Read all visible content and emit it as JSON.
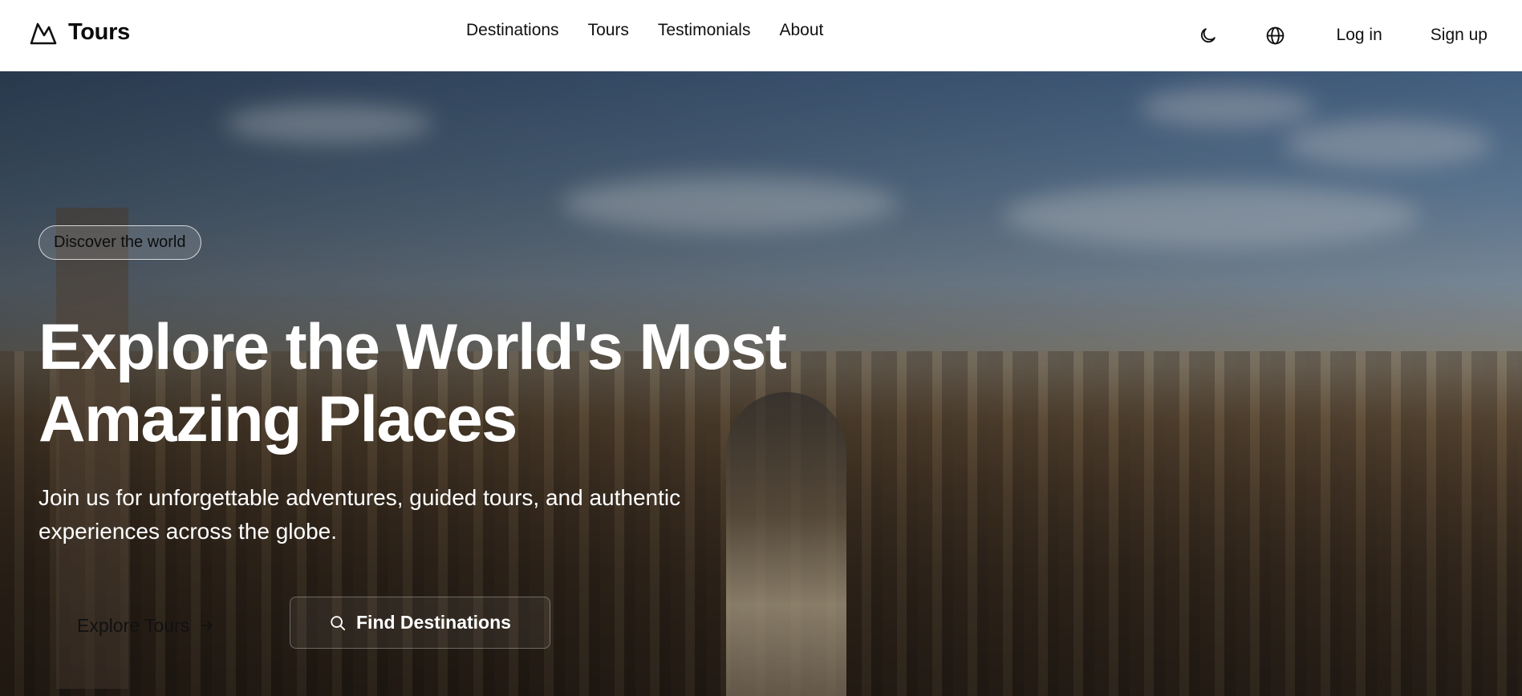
{
  "brand": {
    "name": "Tours",
    "icon": "mountain-icon"
  },
  "nav": {
    "items": [
      {
        "label": "Destinations"
      },
      {
        "label": "Tours"
      },
      {
        "label": "Testimonials"
      },
      {
        "label": "About"
      }
    ]
  },
  "actions": {
    "theme_icon": "moon-icon",
    "language_icon": "globe-icon",
    "login_label": "Log in",
    "signup_label": "Sign up"
  },
  "hero": {
    "badge": "Discover the world",
    "headline_line1": "Explore the World's Most",
    "headline_line2": "Amazing Places",
    "subtext_line1": "Join us for unforgettable adventures, guided tours, and authentic",
    "subtext_line2": "experiences across the globe.",
    "primary_cta": "Explore Tours",
    "primary_cta_icon": "arrow-right-icon",
    "secondary_cta": "Find Destinations",
    "secondary_cta_icon": "search-icon"
  },
  "colors": {
    "topbar_bg": "#ffffff",
    "headline": "#ffffff",
    "text_dark": "#111111"
  }
}
